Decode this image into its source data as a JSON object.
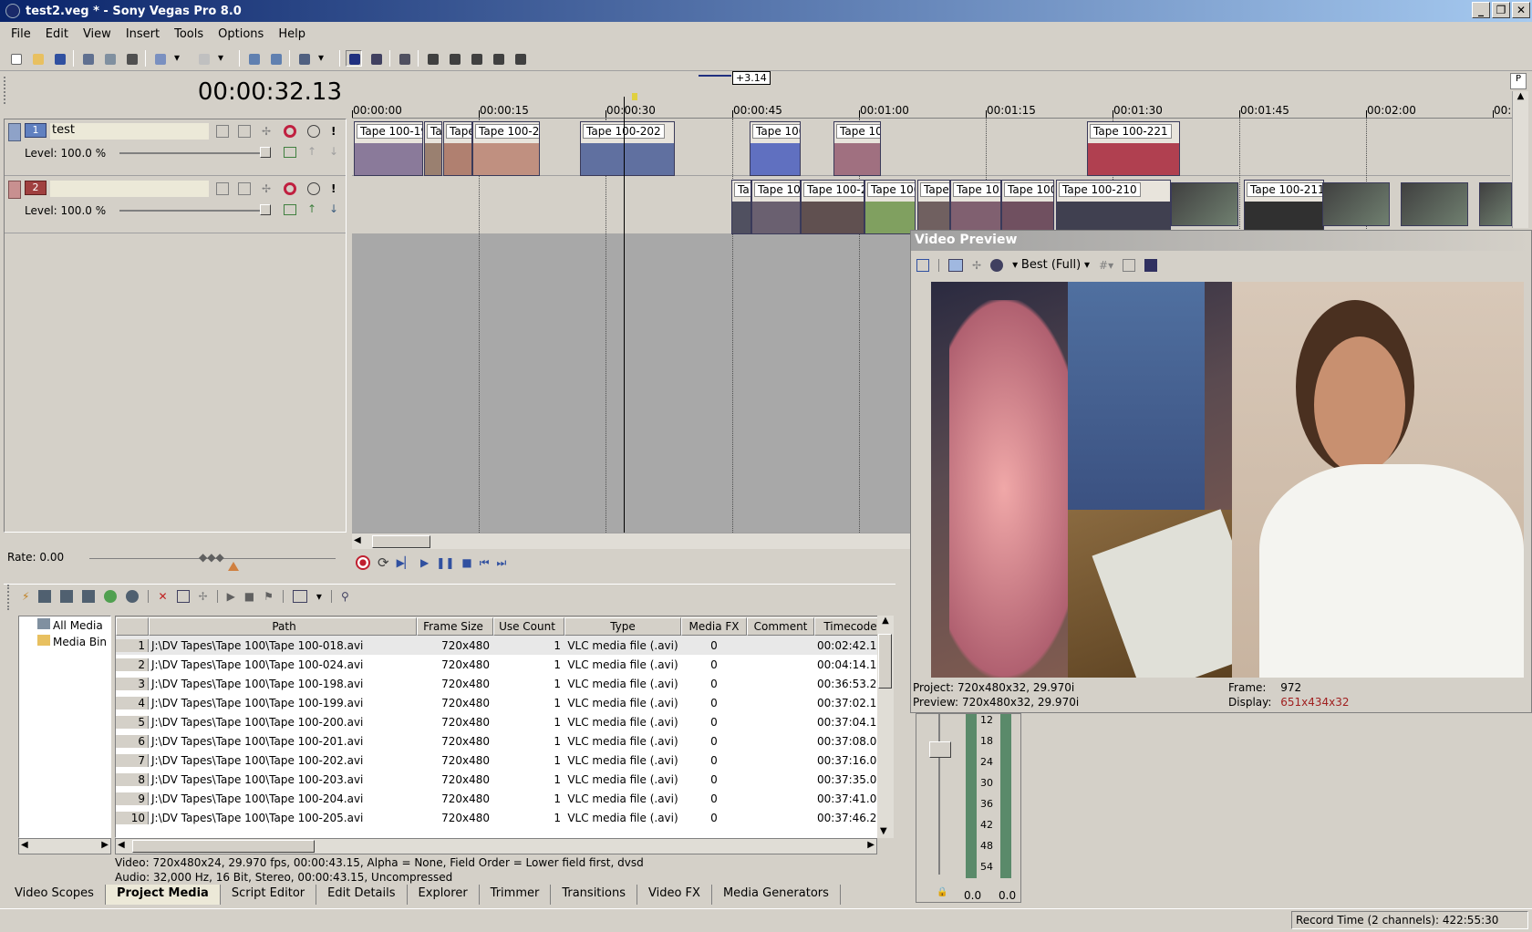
{
  "window": {
    "title": "test2.veg * - Sony Vegas Pro 8.0"
  },
  "menu": [
    "File",
    "Edit",
    "View",
    "Insert",
    "Tools",
    "Options",
    "Help"
  ],
  "timecode": "00:00:32.13",
  "cursor_offset": "+3.14",
  "ruler_ticks": [
    "00:00:00",
    "00:00:15",
    "00:00:30",
    "00:00:45",
    "00:01:00",
    "00:01:15",
    "00:01:30",
    "00:01:45",
    "00:02:00",
    "00:0"
  ],
  "tracks": [
    {
      "number": "1",
      "name": "test",
      "level": "Level: 100.0 %"
    },
    {
      "number": "2",
      "name": "",
      "level": "Level: 100.0 %"
    }
  ],
  "track1_clips": [
    "Tape 100-19",
    "Ta",
    "Tape",
    "Tape 100-2",
    "Tape 100-202",
    "Tape 100",
    "Tape 10",
    "Tape 100-221"
  ],
  "track2_clips": [
    "Ta",
    "Tape 10",
    "Tape 100-2",
    "Tape 100",
    "Tape",
    "Tape 10",
    "Tape 100",
    "Tape 100-210",
    "Tape 100-211"
  ],
  "rate": "Rate: 0.00",
  "preview": {
    "title": "Video Preview",
    "quality": "Best (Full)",
    "project_label": "Project:",
    "project_value": "720x480x32, 29.970i",
    "preview_label": "Preview:",
    "preview_value": "720x480x32, 29.970i",
    "frame_label": "Frame:",
    "frame_value": "972",
    "display_label": "Display:",
    "display_value": "651x434x32"
  },
  "media_tree": [
    "All Media",
    "Media Bin"
  ],
  "media_table": {
    "columns": [
      "",
      "Path",
      "Frame Size",
      "Use Count",
      "Type",
      "Media FX",
      "Comment",
      "Timecode"
    ],
    "rows": [
      [
        "1",
        "J:\\DV Tapes\\Tape 100\\Tape 100-018.avi",
        "720x480",
        "1",
        "VLC media file (.avi)",
        "0",
        "",
        "00:02:42.1"
      ],
      [
        "2",
        "J:\\DV Tapes\\Tape 100\\Tape 100-024.avi",
        "720x480",
        "1",
        "VLC media file (.avi)",
        "0",
        "",
        "00:04:14.1"
      ],
      [
        "3",
        "J:\\DV Tapes\\Tape 100\\Tape 100-198.avi",
        "720x480",
        "1",
        "VLC media file (.avi)",
        "0",
        "",
        "00:36:53.2"
      ],
      [
        "4",
        "J:\\DV Tapes\\Tape 100\\Tape 100-199.avi",
        "720x480",
        "1",
        "VLC media file (.avi)",
        "0",
        "",
        "00:37:02.1"
      ],
      [
        "5",
        "J:\\DV Tapes\\Tape 100\\Tape 100-200.avi",
        "720x480",
        "1",
        "VLC media file (.avi)",
        "0",
        "",
        "00:37:04.1"
      ],
      [
        "6",
        "J:\\DV Tapes\\Tape 100\\Tape 100-201.avi",
        "720x480",
        "1",
        "VLC media file (.avi)",
        "0",
        "",
        "00:37:08.0"
      ],
      [
        "7",
        "J:\\DV Tapes\\Tape 100\\Tape 100-202.avi",
        "720x480",
        "1",
        "VLC media file (.avi)",
        "0",
        "",
        "00:37:16.0"
      ],
      [
        "8",
        "J:\\DV Tapes\\Tape 100\\Tape 100-203.avi",
        "720x480",
        "1",
        "VLC media file (.avi)",
        "0",
        "",
        "00:37:35.0"
      ],
      [
        "9",
        "J:\\DV Tapes\\Tape 100\\Tape 100-204.avi",
        "720x480",
        "1",
        "VLC media file (.avi)",
        "0",
        "",
        "00:37:41.0"
      ],
      [
        "10",
        "J:\\DV Tapes\\Tape 100\\Tape 100-205.avi",
        "720x480",
        "1",
        "VLC media file (.avi)",
        "0",
        "",
        "00:37:46.2"
      ]
    ]
  },
  "media_info": {
    "video": "Video: 720x480x24, 29.970 fps, 00:00:43.15, Alpha = None, Field Order = Lower field first, dvsd",
    "audio": "Audio: 32,000 Hz, 16 Bit, Stereo, 00:00:43.15, Uncompressed"
  },
  "bottom_tabs": [
    "Video Scopes",
    "Project Media",
    "Script Editor",
    "Edit Details",
    "Explorer",
    "Trimmer",
    "Transitions",
    "Video FX",
    "Media Generators"
  ],
  "meter": {
    "scale": [
      "12",
      "18",
      "24",
      "30",
      "36",
      "42",
      "48",
      "54"
    ],
    "left": "0.0",
    "right": "0.0"
  },
  "status": "Record Time (2 channels): 422:55:30"
}
